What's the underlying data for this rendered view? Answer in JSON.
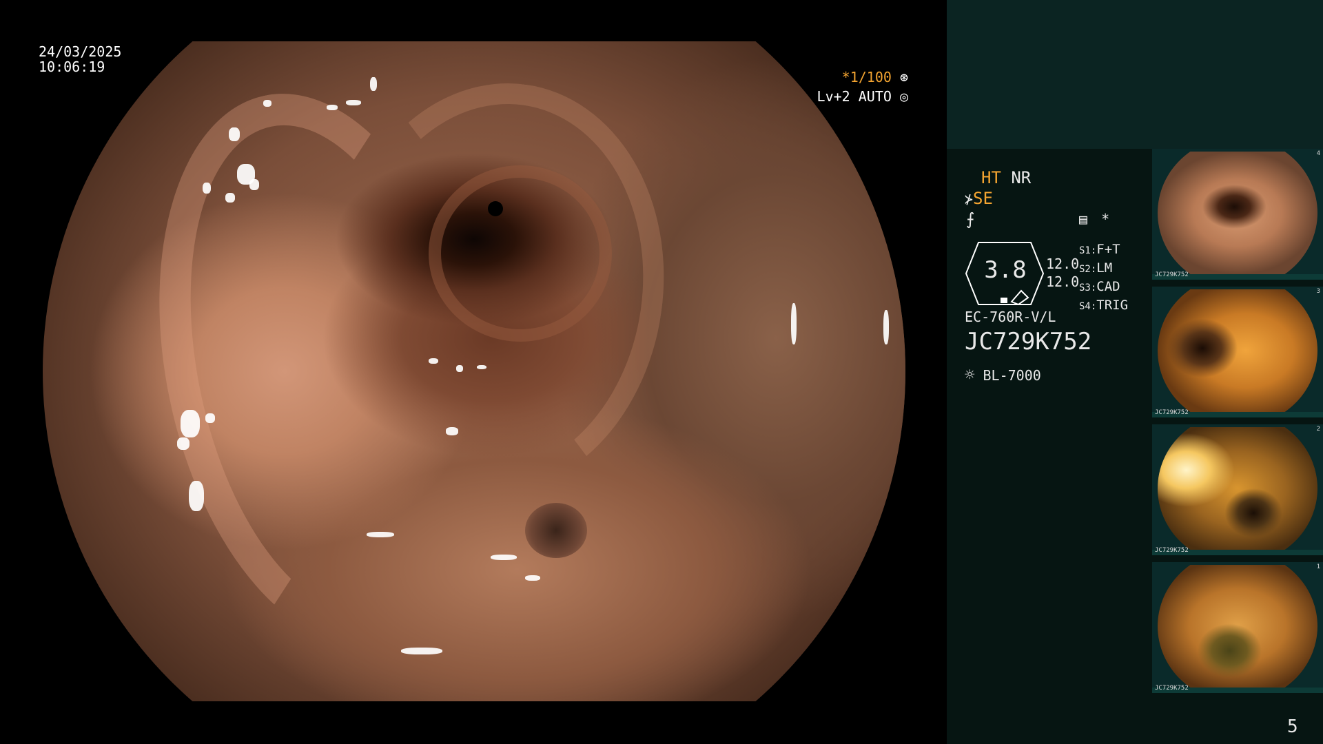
{
  "osd": {
    "date": "24/03/2025",
    "time": "10:06:19",
    "shutter": "*1/100",
    "iris": "Lv+2 AUTO"
  },
  "panel": {
    "ht_label": "HT",
    "nr_label": "NR",
    "se_label": "SE",
    "switch_marker": "*",
    "scale_value": "3.8",
    "values": [
      "12.0",
      "12.0"
    ],
    "switches": [
      {
        "key": "S1:",
        "value": "F+T"
      },
      {
        "key": "S2:",
        "value": "LM"
      },
      {
        "key": "S3:",
        "value": "CAD"
      },
      {
        "key": "S4:",
        "value": "TRIG"
      }
    ],
    "scope_model": "EC-760R-V/L",
    "serial": "JC729K752",
    "light_source": "BL-7000",
    "page_number": "5"
  },
  "thumbnails": [
    {
      "label": "JC729K752",
      "index": "4"
    },
    {
      "label": "JC729K752",
      "index": "3"
    },
    {
      "label": "JC729K752",
      "index": "2"
    },
    {
      "label": "JC729K752",
      "index": "1"
    }
  ],
  "colors": {
    "panel_bg": "#061512",
    "panel_top": "#0b2422",
    "accent_orange": "#f5a531",
    "thumb_bar": "#0d3b37"
  }
}
